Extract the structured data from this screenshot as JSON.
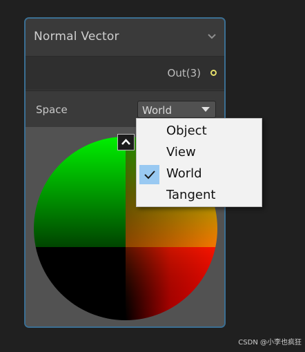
{
  "node": {
    "title": "Normal Vector",
    "output_label": "Out(3)",
    "space_label": "Space",
    "space_value": "World"
  },
  "menu": {
    "items": [
      {
        "label": "Object",
        "checked": false
      },
      {
        "label": "View",
        "checked": false
      },
      {
        "label": "World",
        "checked": true
      },
      {
        "label": "Tangent",
        "checked": false
      }
    ]
  },
  "icons": {
    "header": "chevron-down-icon",
    "port": "output-port-icon",
    "dropdown": "dropdown-arrow-icon",
    "collapse": "chevron-up-icon",
    "check": "checkmark-icon"
  },
  "colors": {
    "node_border": "#3b6f93",
    "port": "#e6e06b",
    "menu_highlight": "#99c9f2"
  },
  "watermark": "CSDN @小李也疯狂"
}
